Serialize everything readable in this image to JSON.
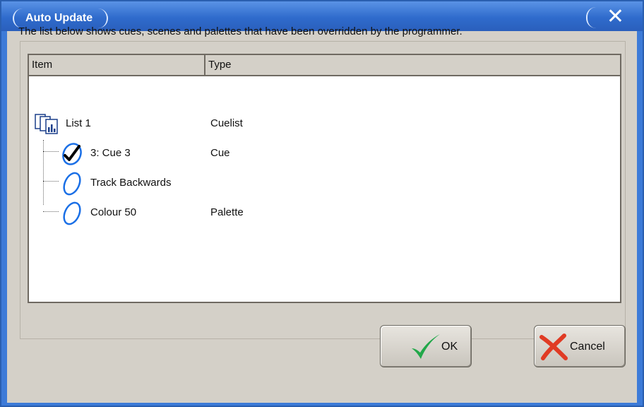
{
  "window": {
    "title": "Auto Update",
    "close_glyph": "✕"
  },
  "description": "The list below shows cues, scenes and palettes that have been overridden by the programmer.",
  "list": {
    "columns": [
      "Item",
      "Type"
    ],
    "rows": [
      {
        "name": "List 1",
        "type": "Cuelist",
        "icon": "cuelist-icon"
      },
      {
        "name": "3: Cue 3",
        "type": "Cue",
        "icon": "checked-cue-icon"
      },
      {
        "name": "Track Backwards",
        "type": "",
        "icon": "unchecked-cue-icon"
      },
      {
        "name": "Colour 50",
        "type": "Palette",
        "icon": "unchecked-palette-icon"
      }
    ]
  },
  "buttons": {
    "ok_label": "OK",
    "cancel_label": "Cancel"
  },
  "colors": {
    "title_bar": "#2f6bcc",
    "dialog_body": "#d4d0c8",
    "ok_check": "#22a84a",
    "cancel_x": "#e03b24",
    "oval_icon": "#1a6fe6"
  }
}
